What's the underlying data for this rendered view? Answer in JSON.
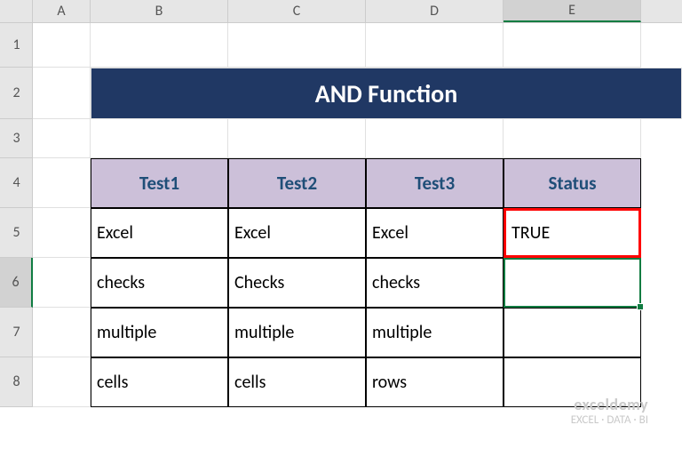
{
  "columns": [
    "A",
    "B",
    "C",
    "D",
    "E"
  ],
  "rows": [
    "1",
    "2",
    "3",
    "4",
    "5",
    "6",
    "7",
    "8"
  ],
  "colWidths": {
    "corner": 37,
    "A": 65,
    "B": 155,
    "C": 155,
    "D": 155,
    "E": 155
  },
  "rowHeights": {
    "1": 50,
    "2": 58,
    "3": 44,
    "4": 56,
    "5": 56,
    "6": 56,
    "7": 56,
    "8": 56
  },
  "activeCell": {
    "row": "6",
    "col": "E"
  },
  "title": "AND Function",
  "headers": {
    "B": "Test1",
    "C": "Test2",
    "D": "Test3",
    "E": "Status"
  },
  "tdata": {
    "5": {
      "B": "Excel",
      "C": "Excel",
      "D": "Excel",
      "E": "TRUE"
    },
    "6": {
      "B": "checks",
      "C": "Checks",
      "D": "checks",
      "E": ""
    },
    "7": {
      "B": "multiple",
      "C": "multiple",
      "D": "multiple",
      "E": ""
    },
    "8": {
      "B": "cells",
      "C": "cells",
      "D": "rows",
      "E": ""
    }
  },
  "watermark": {
    "brand": "exceldemy",
    "tag": "EXCEL · DATA · BI"
  },
  "chart_data": {
    "type": "table",
    "title": "AND Function",
    "columns": [
      "Test1",
      "Test2",
      "Test3",
      "Status"
    ],
    "rows": [
      [
        "Excel",
        "Excel",
        "Excel",
        "TRUE"
      ],
      [
        "checks",
        "Checks",
        "checks",
        ""
      ],
      [
        "multiple",
        "multiple",
        "multiple",
        ""
      ],
      [
        "cells",
        "cells",
        "rows",
        ""
      ]
    ]
  }
}
